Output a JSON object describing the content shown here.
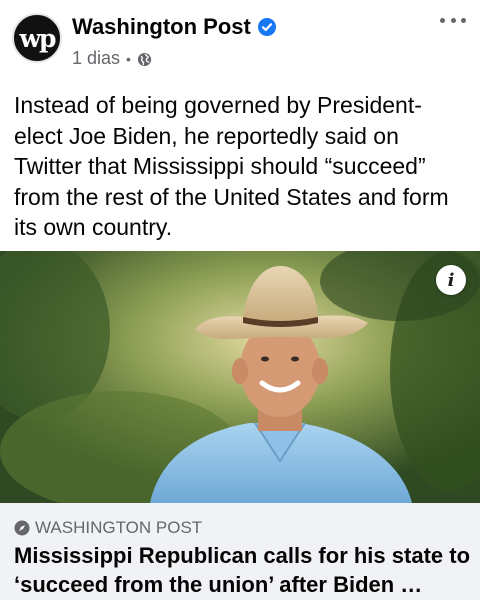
{
  "post": {
    "page_name": "Washington Post",
    "avatar_text": "wp",
    "timestamp": "1 dias",
    "separator": "•",
    "text": "Instead of being governed by President-elect Joe Biden, he reportedly said on Twitter that Mississippi should “succeed” from the rest of the United States and form its own country."
  },
  "link": {
    "domain": "WASHINGTON POST",
    "title": "Mississippi Republican calls for his state to ‘succeed from the union’ after Biden …",
    "info_label": "i"
  },
  "colors": {
    "verified": "#1877f2",
    "secondary_text": "#65676b",
    "preview_bg": "#f0f2f5"
  },
  "icons": [
    "verified-badge-icon",
    "globe-icon",
    "more-options-icon",
    "info-icon",
    "compass-icon"
  ]
}
